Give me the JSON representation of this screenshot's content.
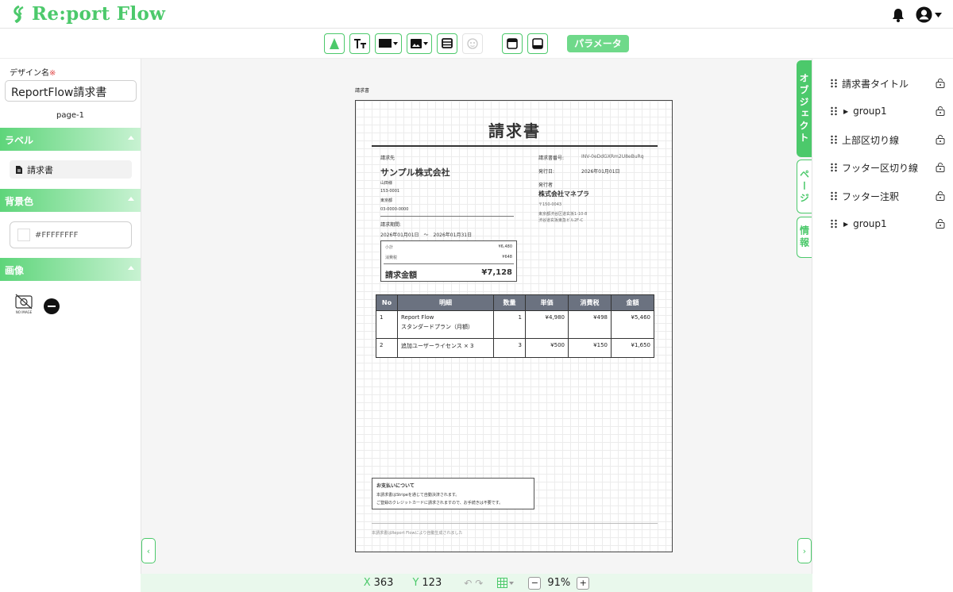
{
  "header": {
    "logo_text": "Re:port Flow",
    "icons": [
      "bell-icon",
      "user-account-icon",
      "caret-down-icon"
    ]
  },
  "toolbar": {
    "param_label": "パラメータ",
    "icons": [
      "select-arrow-icon",
      "text-tool-icon",
      "shape-tool-icon",
      "image-tool-icon",
      "table-tool-icon",
      "emoji-icon",
      "header-region-icon",
      "footer-region-icon"
    ]
  },
  "left_panel": {
    "design_name_label": "デザイン名",
    "required_mark": "※",
    "design_name_value": "ReportFlow請求書",
    "page_label": "page-1",
    "label_section": "ラベル",
    "label_item": "請求書",
    "bg_section": "背景色",
    "bg_value": "#FFFFFFFF",
    "image_section": "画像",
    "no_image_text": "NO IMAGE"
  },
  "canvas": {
    "page_name": "請求書"
  },
  "invoice": {
    "title": "請求書",
    "to_label": "請求先",
    "to_company": "サンプル株式会社",
    "to_person": "山田様",
    "to_zip": "153-0001",
    "to_addr": "東京都",
    "to_tel": "03-0000-0000",
    "period_label": "請求期間:",
    "period_value": "2026年01月01日　〜　2026年01月31日",
    "invoice_no_label": "請求書番号:",
    "invoice_no": "INV-0eDdGXRm2U8eBuRq",
    "issue_label": "発行日:",
    "issue_date": "2026年01月01日",
    "issuer_label": "発行者",
    "issuer_company": "株式会社マネプラ",
    "issuer_zip": "〒150-0043",
    "issuer_addr1": "東京都渋谷区道玄坂1-10-8",
    "issuer_addr2": "渋谷道玄坂東急ビル2F-C",
    "subtotal_label": "小計",
    "subtotal": "¥6,480",
    "tax_label": "消費税",
    "tax": "¥648",
    "total_label": "請求金額",
    "total": "¥7,128",
    "table": {
      "headers": [
        "No",
        "明細",
        "数量",
        "単価",
        "消費税",
        "金額"
      ],
      "rows": [
        {
          "no": "1",
          "desc1": "Report Flow",
          "desc2": "スタンダードプラン（月額）",
          "qty": "1",
          "price": "¥4,980",
          "tax": "¥498",
          "amount": "¥5,460"
        },
        {
          "no": "2",
          "desc1": "追加ユーザーライセンス × 3",
          "desc2": "",
          "qty": "3",
          "price": "¥500",
          "tax": "¥150",
          "amount": "¥1,650"
        }
      ]
    },
    "pay_title": "お支払いについて",
    "pay_line1": "本請求書はStripeを通じて自動決済されます。",
    "pay_line2": "ご登録のクレジットカードに請求されますので、お手続きは不要です。",
    "footer_note": "本請求書はReport Flowにより自動生成されました"
  },
  "side_tabs": {
    "objects": "オブジェクト",
    "page": "ページ",
    "info": "情報"
  },
  "layers": [
    {
      "label": "請求書タイトル",
      "expandable": false
    },
    {
      "label": "group1",
      "expandable": true
    },
    {
      "label": "上部区切り線",
      "expandable": false
    },
    {
      "label": "フッター区切り線",
      "expandable": false
    },
    {
      "label": "フッター注釈",
      "expandable": false
    },
    {
      "label": "group1",
      "expandable": true
    }
  ],
  "statusbar": {
    "x_label": "X",
    "x_value": "363",
    "y_label": "Y",
    "y_value": "123",
    "zoom": "91%",
    "minus": "−",
    "plus": "+"
  },
  "colors": {
    "accent": "#4cc96b",
    "table_header": "#6b7280"
  }
}
